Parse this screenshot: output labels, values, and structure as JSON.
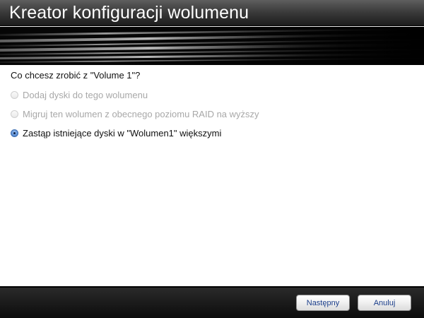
{
  "window": {
    "title": "Kreator konfiguracji wolumenu"
  },
  "content": {
    "question": "Co chcesz zrobić z \"Volume 1\"?",
    "options": [
      {
        "label": "Dodaj dyski do tego wolumenu",
        "selected": false,
        "enabled": false
      },
      {
        "label": "Migruj ten wolumen z obecnego poziomu RAID na wyższy",
        "selected": false,
        "enabled": false
      },
      {
        "label": "Zastąp istniejące dyski w \"Wolumen1\" większymi",
        "selected": true,
        "enabled": true
      }
    ]
  },
  "footer": {
    "next_label": "Następny",
    "cancel_label": "Anuluj"
  }
}
